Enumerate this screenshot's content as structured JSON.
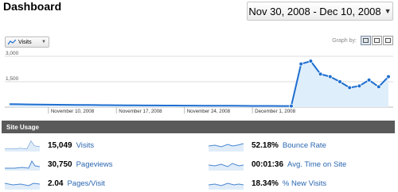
{
  "header": {
    "title": "Dashboard",
    "date_range": "Nov 30, 2008 - Dec 10, 2008"
  },
  "graph_controls": {
    "metric": "Visits",
    "graph_by_label": "Graph by:",
    "graph_by_options": [
      "day",
      "week",
      "month"
    ],
    "graph_by_selected": "day"
  },
  "colors": {
    "line": "#1f6fd0",
    "fill": "#dfeefb",
    "section_bar": "#5a5a5a",
    "link": "#2a66b0"
  },
  "chart_data": {
    "type": "area",
    "yticks": [
      "3,000",
      "1,500"
    ],
    "ylim": [
      0,
      3000
    ],
    "xlabels": [
      "November 10, 2008",
      "November 17, 2008",
      "November 24, 2008",
      "December 1, 2008"
    ],
    "series": [
      {
        "name": "Visits",
        "values": [
          180,
          170,
          160,
          150,
          145,
          140,
          135,
          130,
          125,
          120,
          115,
          112,
          108,
          105,
          100,
          98,
          95,
          92,
          90,
          88,
          85,
          82,
          80,
          78,
          75,
          72,
          70,
          68,
          66,
          65,
          2550,
          2720,
          1950,
          1800,
          1500,
          1150,
          1250,
          1600,
          1200,
          1800
        ]
      }
    ]
  },
  "site_usage": {
    "title": "Site Usage",
    "metrics": [
      {
        "value": "15,049",
        "label": "Visits"
      },
      {
        "value": "30,750",
        "label": "Pageviews"
      },
      {
        "value": "2.04",
        "label": "Pages/Visit"
      },
      {
        "value": "52.18%",
        "label": "Bounce Rate"
      },
      {
        "value": "00:01:36",
        "label": "Avg. Time on Site"
      },
      {
        "value": "18.34%",
        "label": "% New Visits"
      }
    ]
  }
}
